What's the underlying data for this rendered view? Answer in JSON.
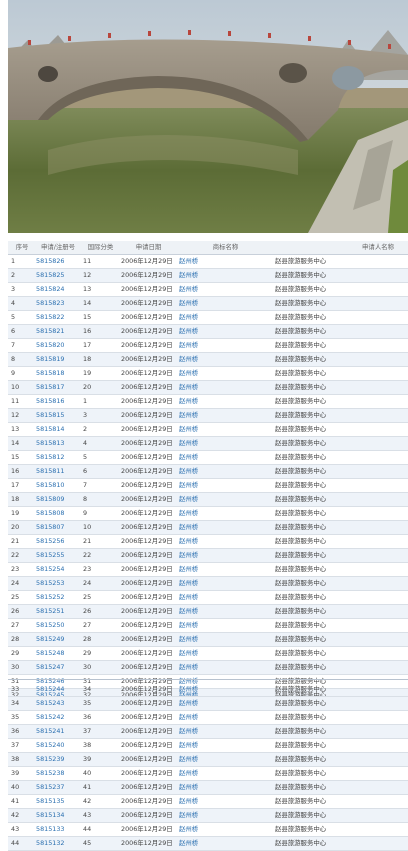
{
  "table": {
    "headers": [
      "序号",
      "申请/注册号",
      "国际分类",
      "申请日期",
      "商标名称",
      "申请人名称"
    ],
    "rows_part1": [
      [
        "1",
        "5815826",
        "11",
        "2006年12月29日",
        "赵州桥",
        "赵县旅游服务中心"
      ],
      [
        "2",
        "5815825",
        "12",
        "2006年12月29日",
        "赵州桥",
        "赵县旅游服务中心"
      ],
      [
        "3",
        "5815824",
        "13",
        "2006年12月29日",
        "赵州桥",
        "赵县旅游服务中心"
      ],
      [
        "4",
        "5815823",
        "14",
        "2006年12月29日",
        "赵州桥",
        "赵县旅游服务中心"
      ],
      [
        "5",
        "5815822",
        "15",
        "2006年12月29日",
        "赵州桥",
        "赵县旅游服务中心"
      ],
      [
        "6",
        "5815821",
        "16",
        "2006年12月29日",
        "赵州桥",
        "赵县旅游服务中心"
      ],
      [
        "7",
        "5815820",
        "17",
        "2006年12月29日",
        "赵州桥",
        "赵县旅游服务中心"
      ],
      [
        "8",
        "5815819",
        "18",
        "2006年12月29日",
        "赵州桥",
        "赵县旅游服务中心"
      ],
      [
        "9",
        "5815818",
        "19",
        "2006年12月29日",
        "赵州桥",
        "赵县旅游服务中心"
      ],
      [
        "10",
        "5815817",
        "20",
        "2006年12月29日",
        "赵州桥",
        "赵县旅游服务中心"
      ],
      [
        "11",
        "5815816",
        "1",
        "2006年12月29日",
        "赵州桥",
        "赵县旅游服务中心"
      ],
      [
        "12",
        "5815815",
        "3",
        "2006年12月29日",
        "赵州桥",
        "赵县旅游服务中心"
      ],
      [
        "13",
        "5815814",
        "2",
        "2006年12月29日",
        "赵州桥",
        "赵县旅游服务中心"
      ],
      [
        "14",
        "5815813",
        "4",
        "2006年12月29日",
        "赵州桥",
        "赵县旅游服务中心"
      ],
      [
        "15",
        "5815812",
        "5",
        "2006年12月29日",
        "赵州桥",
        "赵县旅游服务中心"
      ],
      [
        "16",
        "5815811",
        "6",
        "2006年12月29日",
        "赵州桥",
        "赵县旅游服务中心"
      ],
      [
        "17",
        "5815810",
        "7",
        "2006年12月29日",
        "赵州桥",
        "赵县旅游服务中心"
      ],
      [
        "18",
        "5815809",
        "8",
        "2006年12月29日",
        "赵州桥",
        "赵县旅游服务中心"
      ],
      [
        "19",
        "5815808",
        "9",
        "2006年12月29日",
        "赵州桥",
        "赵县旅游服务中心"
      ],
      [
        "20",
        "5815807",
        "10",
        "2006年12月29日",
        "赵州桥",
        "赵县旅游服务中心"
      ],
      [
        "21",
        "5815256",
        "21",
        "2006年12月29日",
        "赵州桥",
        "赵县旅游服务中心"
      ],
      [
        "22",
        "5815255",
        "22",
        "2006年12月29日",
        "赵州桥",
        "赵县旅游服务中心"
      ],
      [
        "23",
        "5815254",
        "23",
        "2006年12月29日",
        "赵州桥",
        "赵县旅游服务中心"
      ],
      [
        "24",
        "5815253",
        "24",
        "2006年12月29日",
        "赵州桥",
        "赵县旅游服务中心"
      ],
      [
        "25",
        "5815252",
        "25",
        "2006年12月29日",
        "赵州桥",
        "赵县旅游服务中心"
      ],
      [
        "26",
        "5815251",
        "26",
        "2006年12月29日",
        "赵州桥",
        "赵县旅游服务中心"
      ],
      [
        "27",
        "5815250",
        "27",
        "2006年12月29日",
        "赵州桥",
        "赵县旅游服务中心"
      ],
      [
        "28",
        "5815249",
        "28",
        "2006年12月29日",
        "赵州桥",
        "赵县旅游服务中心"
      ],
      [
        "29",
        "5815248",
        "29",
        "2006年12月29日",
        "赵州桥",
        "赵县旅游服务中心"
      ],
      [
        "30",
        "5815247",
        "30",
        "2006年12月29日",
        "赵州桥",
        "赵县旅游服务中心"
      ],
      [
        "31",
        "5815246",
        "31",
        "2006年12月29日",
        "赵州桥",
        "赵县旅游服务中心"
      ],
      [
        "32",
        "5815245",
        "32",
        "2006年12月29日",
        "赵州桥",
        "赵县旅游服务中心"
      ]
    ],
    "rows_part2": [
      [
        "33",
        "5815244",
        "34",
        "2006年12月29日",
        "赵州桥",
        "赵县旅游服务中心"
      ],
      [
        "34",
        "5815243",
        "35",
        "2006年12月29日",
        "赵州桥",
        "赵县旅游服务中心"
      ],
      [
        "35",
        "5815242",
        "36",
        "2006年12月29日",
        "赵州桥",
        "赵县旅游服务中心"
      ],
      [
        "36",
        "5815241",
        "37",
        "2006年12月29日",
        "赵州桥",
        "赵县旅游服务中心"
      ],
      [
        "37",
        "5815240",
        "38",
        "2006年12月29日",
        "赵州桥",
        "赵县旅游服务中心"
      ],
      [
        "38",
        "5815239",
        "39",
        "2006年12月29日",
        "赵州桥",
        "赵县旅游服务中心"
      ],
      [
        "39",
        "5815238",
        "40",
        "2006年12月29日",
        "赵州桥",
        "赵县旅游服务中心"
      ],
      [
        "40",
        "5815237",
        "41",
        "2006年12月29日",
        "赵州桥",
        "赵县旅游服务中心"
      ],
      [
        "41",
        "5815135",
        "42",
        "2006年12月29日",
        "赵州桥",
        "赵县旅游服务中心"
      ],
      [
        "42",
        "5815134",
        "43",
        "2006年12月29日",
        "赵州桥",
        "赵县旅游服务中心"
      ],
      [
        "43",
        "5815133",
        "44",
        "2006年12月29日",
        "赵州桥",
        "赵县旅游服务中心"
      ],
      [
        "44",
        "5815132",
        "45",
        "2006年12月29日",
        "赵州桥",
        "赵县旅游服务中心"
      ]
    ]
  }
}
